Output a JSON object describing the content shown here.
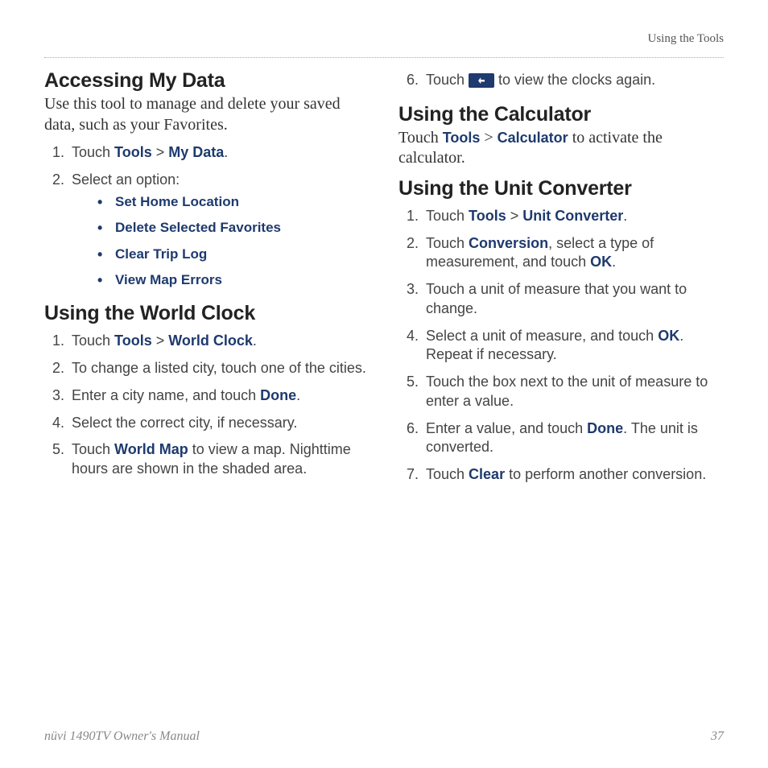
{
  "header": {
    "breadcrumb": "Using the Tools"
  },
  "left": {
    "s1": {
      "title": "Accessing My Data",
      "intro": "Use this tool to manage and delete your saved data, such as your Favorites.",
      "step1_a": "Touch ",
      "step1_kw1": "Tools",
      "step1_gt": " > ",
      "step1_kw2": "My Data",
      "step1_b": ".",
      "step2": "Select an option:",
      "bullets": {
        "b1": "Set Home Location",
        "b2": "Delete Selected Favorites",
        "b3": "Clear Trip Log",
        "b4": "View Map Errors"
      }
    },
    "s2": {
      "title": "Using the World Clock",
      "st1_a": "Touch ",
      "st1_kw1": "Tools",
      "st1_gt": " > ",
      "st1_kw2": "World Clock",
      "st1_b": ".",
      "st2": "To change a listed city, touch one of the cities.",
      "st3_a": "Enter a city name, and touch ",
      "st3_kw": "Done",
      "st3_b": ".",
      "st4": "Select the correct city, if necessary.",
      "st5_a": "Touch ",
      "st5_kw": "World Map",
      "st5_b": " to view a map. Nighttime hours are shown in the shaded area."
    }
  },
  "right": {
    "cont": {
      "st6_a": "Touch ",
      "st6_b": " to view the clocks again."
    },
    "s3": {
      "title": "Using the Calculator",
      "intro_a": "Touch ",
      "intro_kw1": "Tools",
      "intro_gt": " > ",
      "intro_kw2": "Calculator",
      "intro_b": " to activate the calculator."
    },
    "s4": {
      "title": "Using the Unit Converter",
      "st1_a": "Touch ",
      "st1_kw1": "Tools",
      "st1_gt": " > ",
      "st1_kw2": "Unit Converter",
      "st1_b": ".",
      "st2_a": "Touch ",
      "st2_kw1": "Conversion",
      "st2_b": ", select a type of measurement, and touch ",
      "st2_kw2": "OK",
      "st2_c": ".",
      "st3": "Touch a unit of measure that you want to change.",
      "st4_a": "Select a unit of measure, and touch ",
      "st4_kw": "OK",
      "st4_b": ". Repeat if necessary.",
      "st5": "Touch the box next to the unit of measure to enter a value.",
      "st6_a": "Enter a value, and touch ",
      "st6_kw": "Done",
      "st6_b": ". The unit is converted.",
      "st7_a": "Touch ",
      "st7_kw": "Clear",
      "st7_b": " to perform another conversion."
    }
  },
  "footer": {
    "manual": "nüvi 1490TV Owner's Manual",
    "page": "37"
  }
}
